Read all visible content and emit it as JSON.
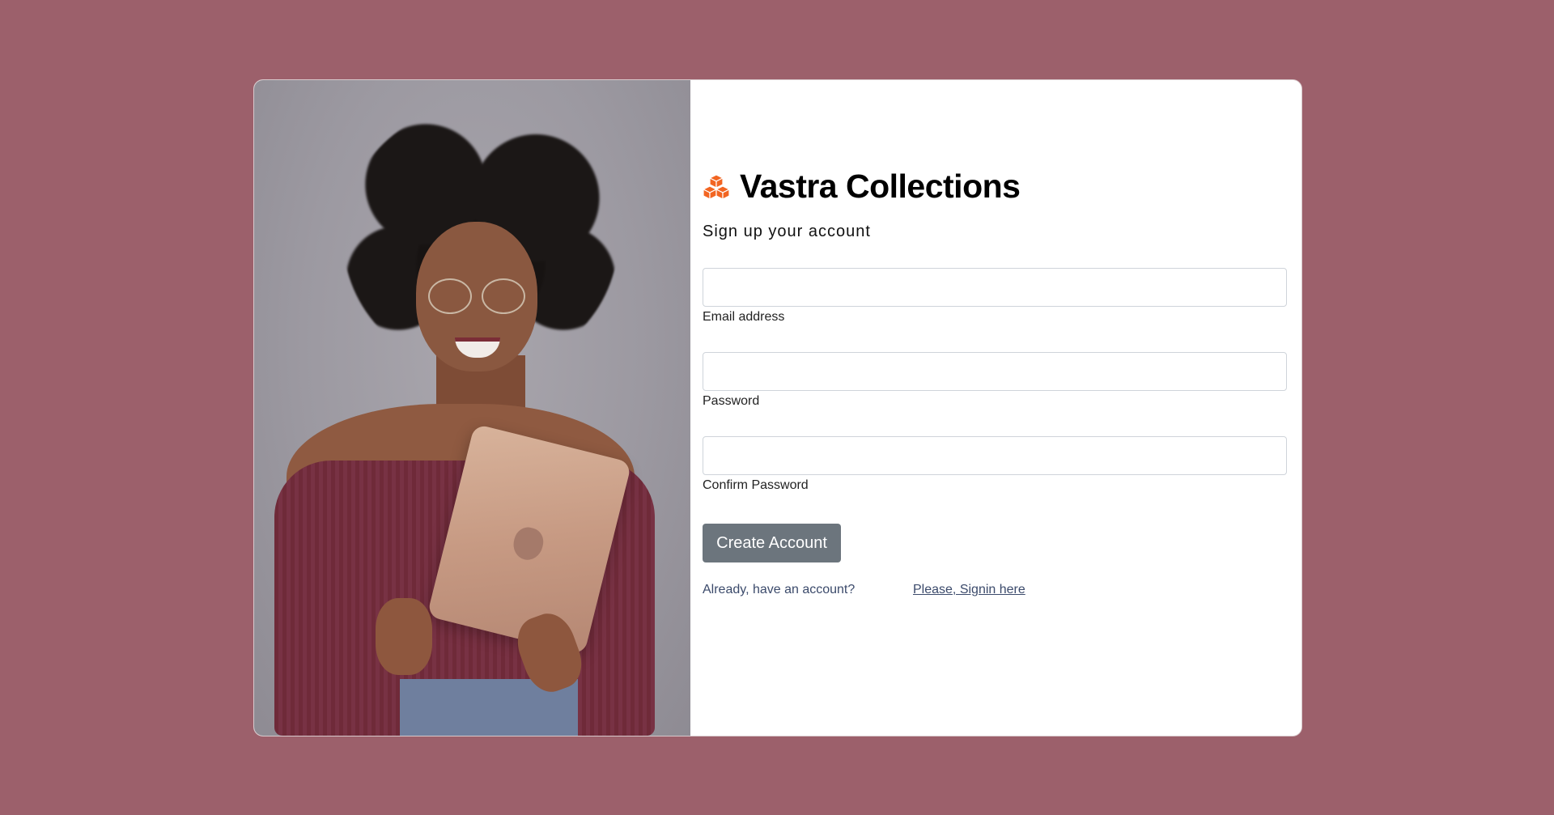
{
  "brand": {
    "name": "Vastra Collections",
    "icon": "boxes-icon",
    "icon_color": "#f26522"
  },
  "form": {
    "subtitle": "Sign up your account",
    "email": {
      "label": "Email address",
      "value": "",
      "placeholder": ""
    },
    "password": {
      "label": "Password",
      "value": "",
      "placeholder": ""
    },
    "confirm_password": {
      "label": "Confirm Password",
      "value": "",
      "placeholder": ""
    },
    "submit_label": "Create Account",
    "signin_prompt": "Already, have an account?",
    "signin_link": "Please, Signin here"
  },
  "colors": {
    "page_background": "#9c606b",
    "button_background": "#6c757d",
    "link_color": "#3b4a6b"
  }
}
